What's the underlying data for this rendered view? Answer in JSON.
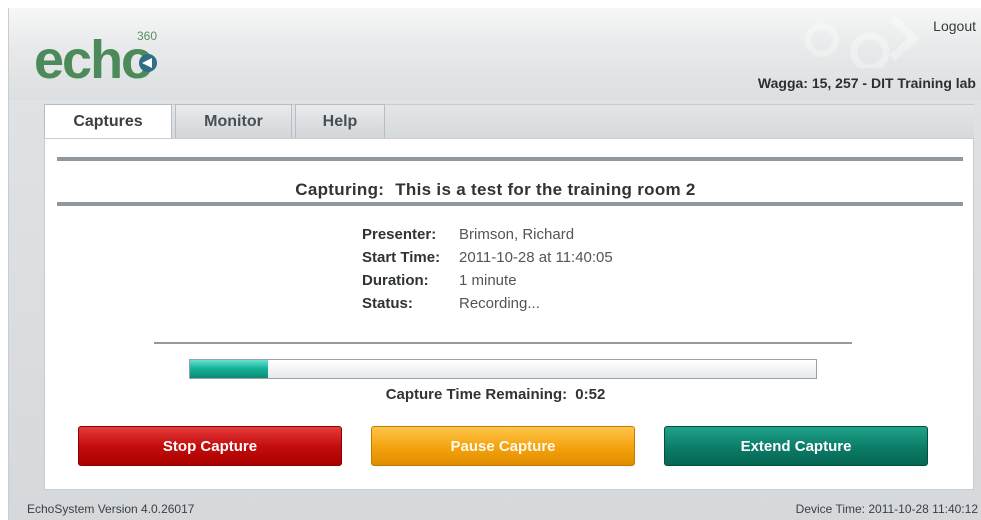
{
  "header": {
    "logo_text": "echo",
    "logo_superscript": "360",
    "logout_label": "Logout",
    "location": "Wagga: 15, 257 - DIT Training lab"
  },
  "tabs": [
    {
      "label": "Captures",
      "active": true
    },
    {
      "label": "Monitor",
      "active": false
    },
    {
      "label": "Help",
      "active": false
    }
  ],
  "capture": {
    "title_prefix": "Capturing:",
    "title": "This is a test for the training room 2",
    "details": [
      {
        "label": "Presenter:",
        "value": "Brimson, Richard"
      },
      {
        "label": "Start Time:",
        "value": "2011-10-28 at 11:40:05"
      },
      {
        "label": "Duration:",
        "value": "1 minute"
      },
      {
        "label": "Status:",
        "value": "Recording..."
      }
    ],
    "progress_fraction": 0.125,
    "remaining_label": "Capture Time Remaining:",
    "remaining_value": "0:52"
  },
  "buttons": {
    "stop": "Stop Capture",
    "pause": "Pause Capture",
    "extend": "Extend Capture"
  },
  "footer": {
    "version": "EchoSystem Version 4.0.26017",
    "device_time": "Device Time: 2011-10-28 11:40:12"
  },
  "colors": {
    "stop": "#c40d0d",
    "pause": "#f3a20e",
    "extend": "#0b7c67",
    "progress": "#17b59a"
  }
}
